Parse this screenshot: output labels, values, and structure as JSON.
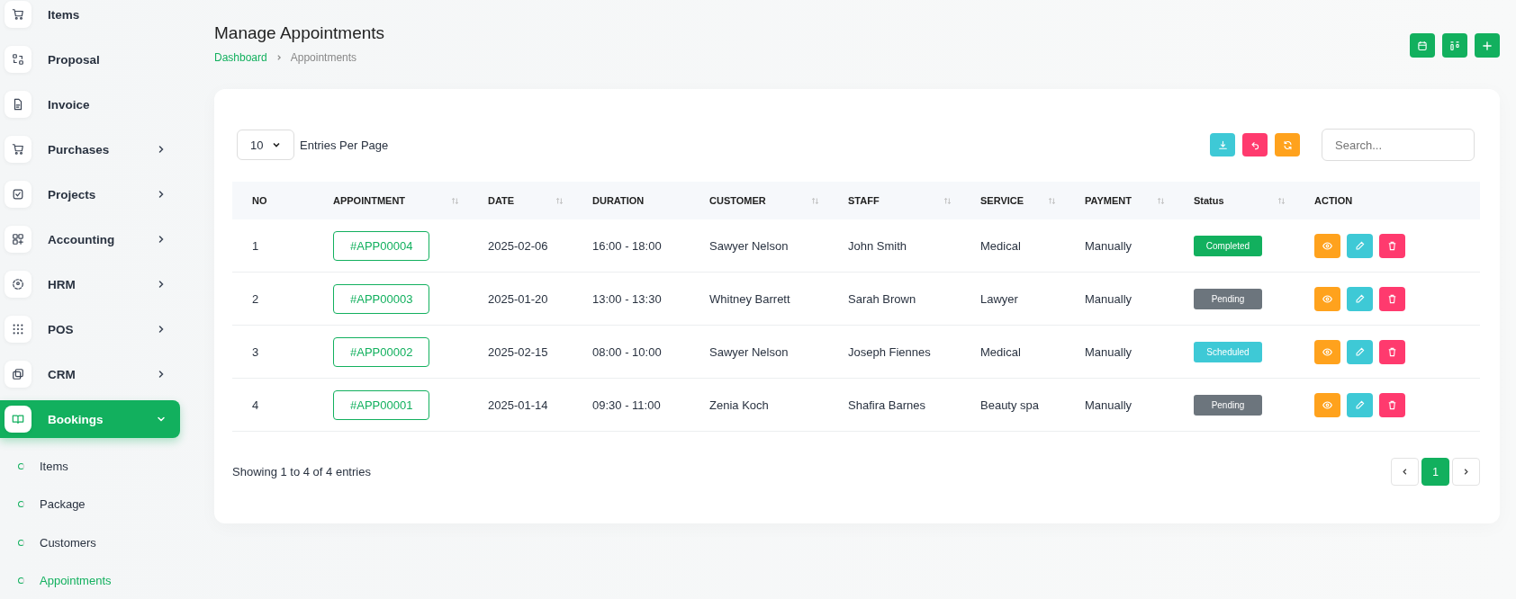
{
  "sidebar": {
    "items": [
      {
        "label": "Items",
        "has_submenu": false,
        "selected": false
      },
      {
        "label": "Proposal",
        "has_submenu": false,
        "selected": false
      },
      {
        "label": "Invoice",
        "has_submenu": false,
        "selected": false
      },
      {
        "label": "Purchases",
        "has_submenu": true,
        "selected": false
      },
      {
        "label": "Projects",
        "has_submenu": true,
        "selected": false
      },
      {
        "label": "Accounting",
        "has_submenu": true,
        "selected": false
      },
      {
        "label": "HRM",
        "has_submenu": true,
        "selected": false
      },
      {
        "label": "POS",
        "has_submenu": true,
        "selected": false
      },
      {
        "label": "CRM",
        "has_submenu": true,
        "selected": false
      },
      {
        "label": "Bookings",
        "has_submenu": true,
        "selected": true,
        "expanded": true,
        "children": [
          {
            "label": "Items",
            "selected": false
          },
          {
            "label": "Package",
            "selected": false
          },
          {
            "label": "Customers",
            "selected": false
          },
          {
            "label": "Appointments",
            "selected": true
          }
        ]
      }
    ]
  },
  "page": {
    "title": "Manage Appointments",
    "breadcrumb": [
      "Dashboard",
      "Appointments"
    ]
  },
  "table_controls": {
    "page_size": "10",
    "page_size_label": "Entries Per Page",
    "search": {
      "placeholder": "Search..."
    }
  },
  "table": {
    "columns": [
      {
        "label": "NO",
        "sortable": false
      },
      {
        "label": "APPOINTMENT",
        "sortable": true
      },
      {
        "label": "DATE",
        "sortable": true
      },
      {
        "label": "DURATION",
        "sortable": false
      },
      {
        "label": "CUSTOMER",
        "sortable": true
      },
      {
        "label": "STAFF",
        "sortable": true
      },
      {
        "label": "SERVICE",
        "sortable": true
      },
      {
        "label": "PAYMENT",
        "sortable": true
      },
      {
        "label": "Status",
        "sortable": true
      },
      {
        "label": "ACTION",
        "sortable": false
      }
    ],
    "rows": [
      {
        "no": "1",
        "appointment": "#APP00004",
        "date": "2025-02-06",
        "duration": "16:00 - 18:00",
        "customer": "Sawyer Nelson",
        "staff": "John Smith",
        "service": "Medical",
        "payment": "Manually",
        "status": {
          "label": "Completed",
          "color": "#12b05e"
        }
      },
      {
        "no": "2",
        "appointment": "#APP00003",
        "date": "2025-01-20",
        "duration": "13:00 - 13:30",
        "customer": "Whitney Barrett",
        "staff": "Sarah Brown",
        "service": "Lawyer",
        "payment": "Manually",
        "status": {
          "label": "Pending",
          "color": "#6c757d"
        }
      },
      {
        "no": "3",
        "appointment": "#APP00002",
        "date": "2025-02-15",
        "duration": "08:00 - 10:00",
        "customer": "Sawyer Nelson",
        "staff": "Joseph Fiennes",
        "service": "Medical",
        "payment": "Manually",
        "status": {
          "label": "Scheduled",
          "color": "#3ec9d6"
        }
      },
      {
        "no": "4",
        "appointment": "#APP00001",
        "date": "2025-01-14",
        "duration": "09:30 - 11:00",
        "customer": "Zenia Koch",
        "staff": "Shafira Barnes",
        "service": "Beauty spa",
        "payment": "Manually",
        "status": {
          "label": "Pending",
          "color": "#6c757d"
        }
      }
    ]
  },
  "footer": {
    "summary": "Showing 1 to 4 of 4 entries",
    "pages": [
      {
        "label": "1",
        "selected": true
      }
    ]
  }
}
